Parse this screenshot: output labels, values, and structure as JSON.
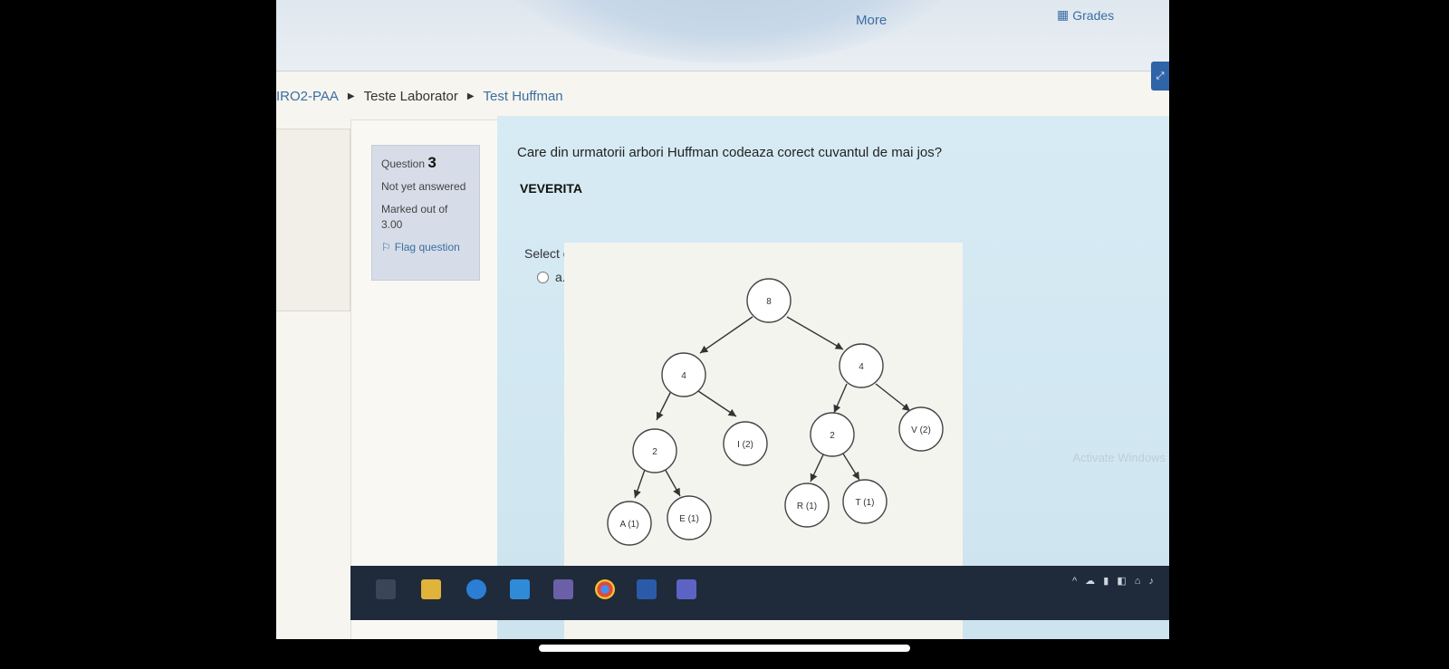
{
  "top_nav": {
    "more_label": "More",
    "grades_label": "Grades"
  },
  "breadcrumb": {
    "course": "IRO2-PAA",
    "section": "Teste Laborator",
    "current": "Test Huffman"
  },
  "question_info": {
    "question_prefix": "Question",
    "question_number": "3",
    "status": "Not yet answered",
    "marked_out_of": "Marked out of 3.00",
    "flag_label": "Flag question"
  },
  "question": {
    "text": "Care din urmatorii arbori Huffman codeaza corect cuvantul de mai jos?",
    "word": "VEVERITA",
    "select_label": "Select one:",
    "option_a_label": "a."
  },
  "tree": {
    "nodes": {
      "root": "8",
      "left": "4",
      "right": "4",
      "left_left": "2",
      "i": "I (2)",
      "right_left": "2",
      "v": "V (2)",
      "a": "A (1)",
      "e": "E (1)",
      "r": "R (1)",
      "t": "T (1)"
    }
  },
  "watermark": "Activate Windows",
  "colors": {
    "link": "#3b6ea3",
    "question_bg": "#d7ebf4",
    "info_bg": "#d6dde8"
  }
}
